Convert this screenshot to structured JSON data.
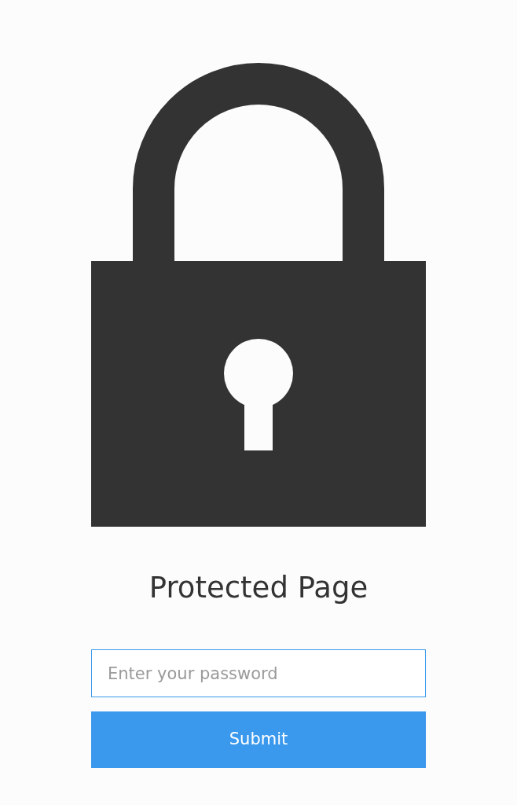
{
  "title": "Protected Page",
  "password_field": {
    "placeholder": "Enter your password"
  },
  "submit_button": {
    "label": "Submit"
  }
}
